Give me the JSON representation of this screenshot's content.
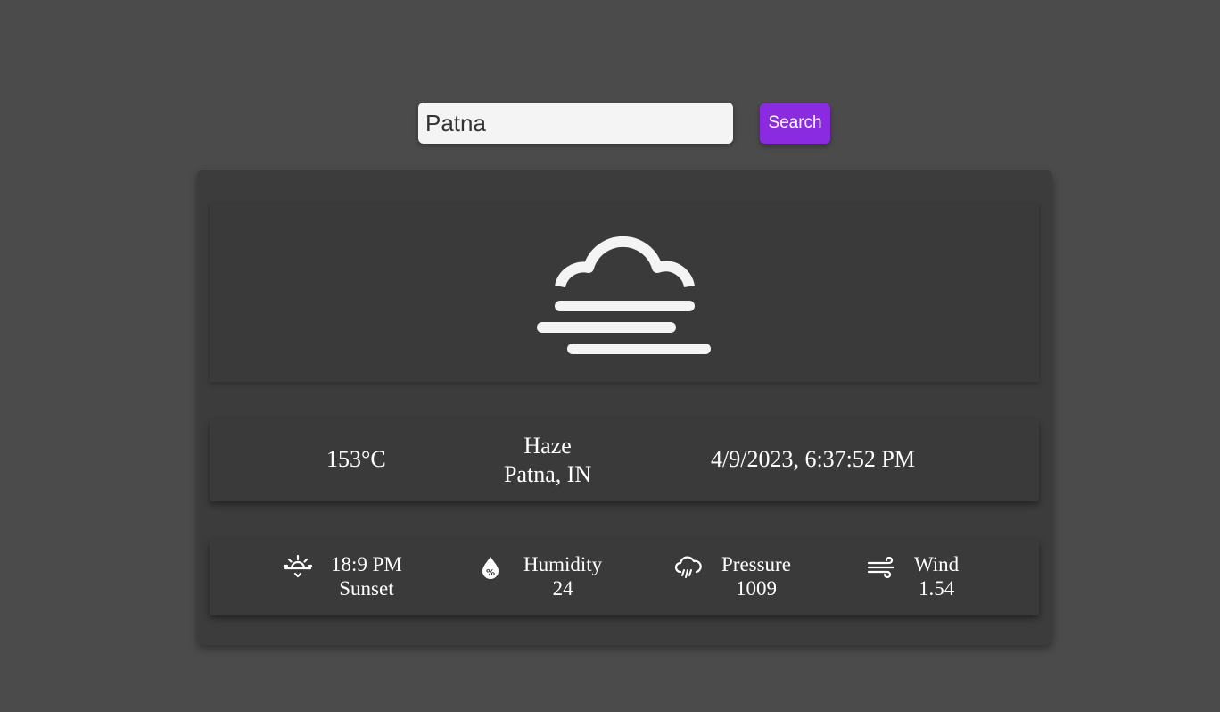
{
  "search": {
    "value": "Patna",
    "button_label": "Search"
  },
  "weather": {
    "icon": "haze-icon",
    "temperature": "153°C",
    "condition": "Haze",
    "location": "Patna, IN",
    "datetime": "4/9/2023, 6:37:52 PM"
  },
  "details": [
    {
      "icon": "sunset-icon",
      "value": "18:9 PM",
      "label": "Sunset"
    },
    {
      "icon": "humidity-icon",
      "label": "Humidity",
      "value": "24"
    },
    {
      "icon": "pressure-icon",
      "label": "Pressure",
      "value": "1009"
    },
    {
      "icon": "wind-icon",
      "label": "Wind",
      "value": "1.54"
    }
  ],
  "colors": {
    "background": "#4b4b4b",
    "card": "#3c3c3c",
    "accent": "#8a2be2",
    "text": "#ffffff"
  }
}
